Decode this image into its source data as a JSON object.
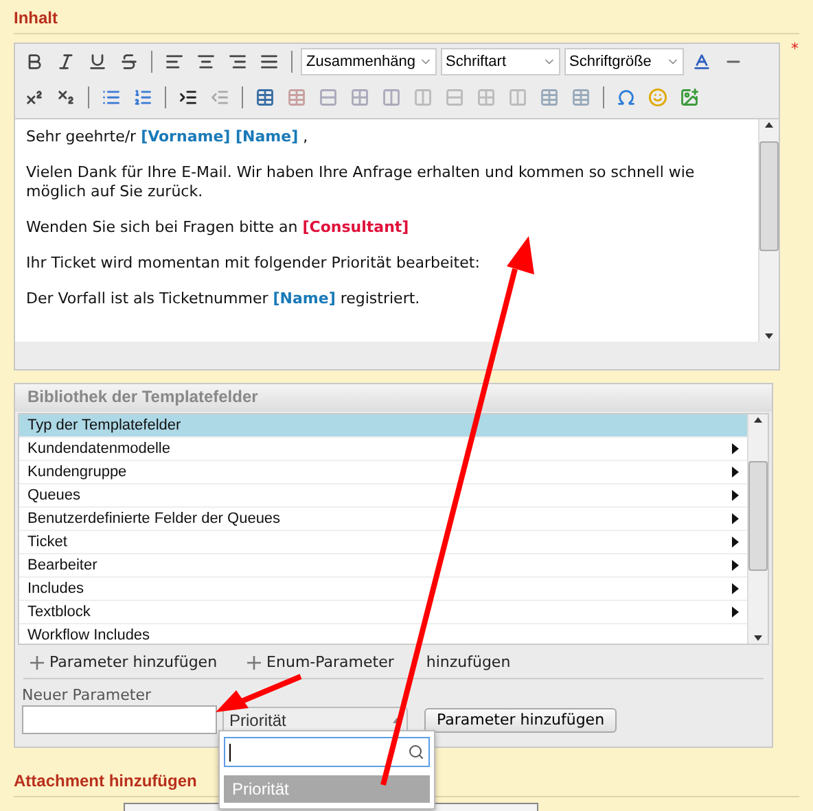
{
  "section_title": "Inhalt",
  "required_mark": "*",
  "editor": {
    "style_selects": [
      {
        "value": "Zusammenhäng"
      },
      {
        "value": "Schriftart"
      },
      {
        "value": "Schriftgröße"
      }
    ],
    "paragraphs": [
      [
        {
          "kind": "plain",
          "text": "Sehr geehrte/r "
        },
        {
          "kind": "field",
          "text": "[Vorname] [Name]",
          "color": "#1a7ab8"
        },
        {
          "kind": "plain",
          "text": " ,"
        }
      ],
      [
        {
          "kind": "plain",
          "text": "Vielen Dank für Ihre E-Mail. Wir haben Ihre Anfrage erhalten und kommen so schnell wie möglich auf Sie zurück."
        }
      ],
      [
        {
          "kind": "plain",
          "text": "Wenden Sie sich bei Fragen bitte an "
        },
        {
          "kind": "field",
          "text": "[Consultant]",
          "color": "#e0103a"
        }
      ],
      [
        {
          "kind": "plain",
          "text": "Ihr Ticket wird momentan mit folgender Priorität bearbeitet:"
        }
      ],
      [
        {
          "kind": "plain",
          "text": "Der Vorfall ist als Ticketnummer "
        },
        {
          "kind": "field",
          "text": "[Name]",
          "color": "#1a7ab8"
        },
        {
          "kind": "plain",
          "text": " registriert."
        }
      ]
    ]
  },
  "library": {
    "title": "Bibliothek der Templatefelder",
    "items": [
      {
        "label": "Typ der Templatefelder",
        "selected": true,
        "has_submenu": false
      },
      {
        "label": "Kundendatenmodelle",
        "selected": false,
        "has_submenu": true
      },
      {
        "label": "Kundengruppe",
        "selected": false,
        "has_submenu": true
      },
      {
        "label": "Queues",
        "selected": false,
        "has_submenu": true
      },
      {
        "label": "Benutzerdefinierte Felder der Queues",
        "selected": false,
        "has_submenu": true
      },
      {
        "label": "Ticket",
        "selected": false,
        "has_submenu": true
      },
      {
        "label": "Bearbeiter",
        "selected": false,
        "has_submenu": true
      },
      {
        "label": "Includes",
        "selected": false,
        "has_submenu": true
      },
      {
        "label": "Textblock",
        "selected": false,
        "has_submenu": true
      },
      {
        "label": "Workflow Includes",
        "selected": false,
        "has_submenu": false
      }
    ],
    "add_links": [
      "Parameter hinzufügen",
      "Enum-Parameter hinzufügen"
    ],
    "new_parameter_label": "Neuer Parameter",
    "type_select": {
      "value": "Priorität",
      "expanded": true,
      "options": [
        {
          "label": "Priorität",
          "selected": true
        }
      ]
    },
    "add_button": "Parameter hinzufügen"
  },
  "attachment": {
    "title": "Attachment hinzufügen"
  }
}
